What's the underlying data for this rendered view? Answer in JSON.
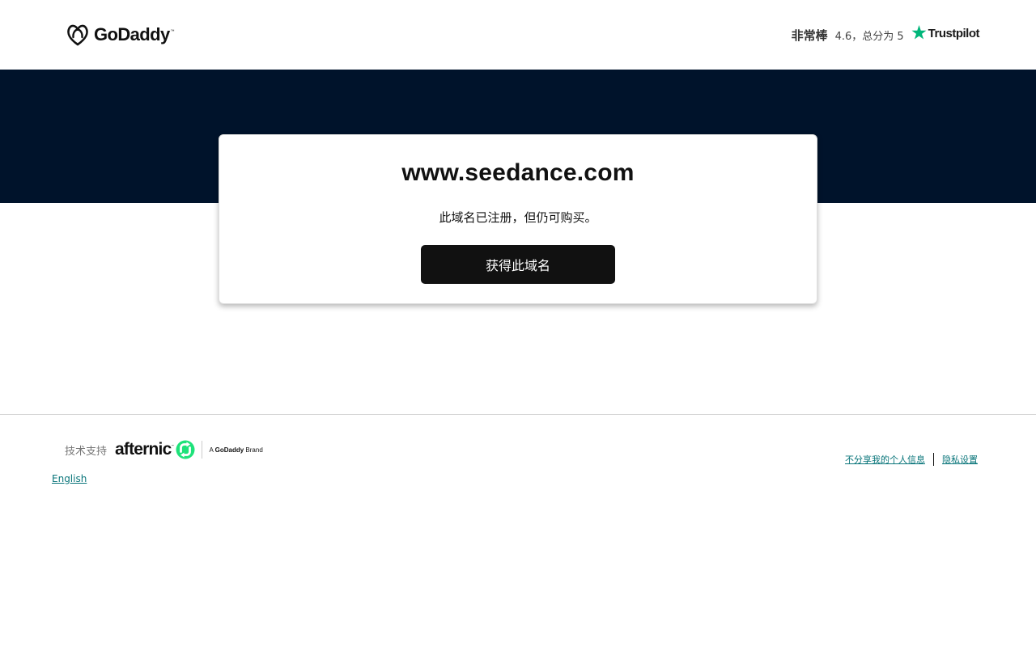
{
  "header": {
    "logo_text": "GoDaddy",
    "logo_tm": "™",
    "rating_word": "非常棒",
    "rating_score": "4.6，总分为 5",
    "rating_brand": "Trustpilot"
  },
  "card": {
    "domain": "www.seedance.com",
    "subtitle": "此域名已注册，但仍可购买。",
    "button_label": "获得此域名"
  },
  "footer": {
    "powered_label": "技术支持",
    "afternic_text": "afternic",
    "afternic_tm": "™",
    "brand_note_prefix": "A",
    "brand_note_name": "GoDaddy",
    "brand_note_suffix": "Brand",
    "language_link": "English",
    "legal_links": [
      "不分享我的个人信息",
      "隐私设置"
    ]
  },
  "colors": {
    "hero_background": "#00132b",
    "button_background": "#111111",
    "link": "#09757a",
    "trustpilot_star": "#00b67a",
    "afternic_green": "#1ee27a"
  },
  "icons": {
    "logo": "godaddy-heart-icon",
    "rating": "trustpilot-star-icon",
    "afternic": "afternic-arrows-icon"
  }
}
